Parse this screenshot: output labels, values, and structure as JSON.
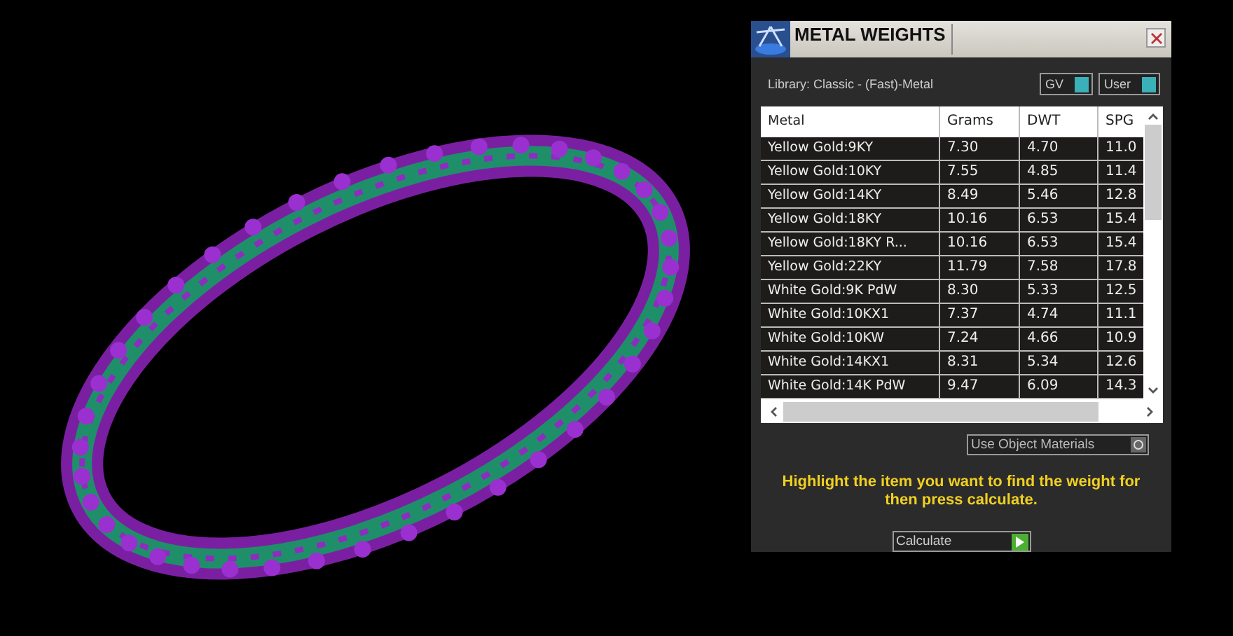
{
  "window": {
    "title": "METAL WEIGHTS"
  },
  "library": {
    "label": "Library: Classic - (Fast)-Metal"
  },
  "toggles": [
    {
      "label": "GV"
    },
    {
      "label": "User"
    }
  ],
  "table": {
    "columns": [
      "Metal",
      "Grams",
      "DWT",
      "SPG"
    ],
    "rows": [
      [
        "Yellow Gold:9KY",
        "7.30",
        "4.70",
        "11.0"
      ],
      [
        "Yellow Gold:10KY",
        "7.55",
        "4.85",
        "11.4"
      ],
      [
        "Yellow Gold:14KY",
        "8.49",
        "5.46",
        "12.8"
      ],
      [
        "Yellow Gold:18KY",
        "10.16",
        "6.53",
        "15.4"
      ],
      [
        "Yellow Gold:18KY R...",
        "10.16",
        "6.53",
        "15.4"
      ],
      [
        "Yellow Gold:22KY",
        "11.79",
        "7.58",
        "17.8"
      ],
      [
        "White Gold:9K PdW",
        "8.30",
        "5.33",
        "12.5"
      ],
      [
        "White Gold:10KX1",
        "7.37",
        "4.74",
        "11.1"
      ],
      [
        "White Gold:10KW",
        "7.24",
        "4.66",
        "10.9"
      ],
      [
        "White Gold:14KX1",
        "8.31",
        "5.34",
        "12.6"
      ],
      [
        "White Gold:14K PdW",
        "9.47",
        "6.09",
        "14.3"
      ]
    ]
  },
  "object_materials": {
    "label": "Use Object Materials"
  },
  "hint": "Highlight the item you want to find the weight for then press calculate.",
  "calculate_button": {
    "label": "Calculate"
  }
}
